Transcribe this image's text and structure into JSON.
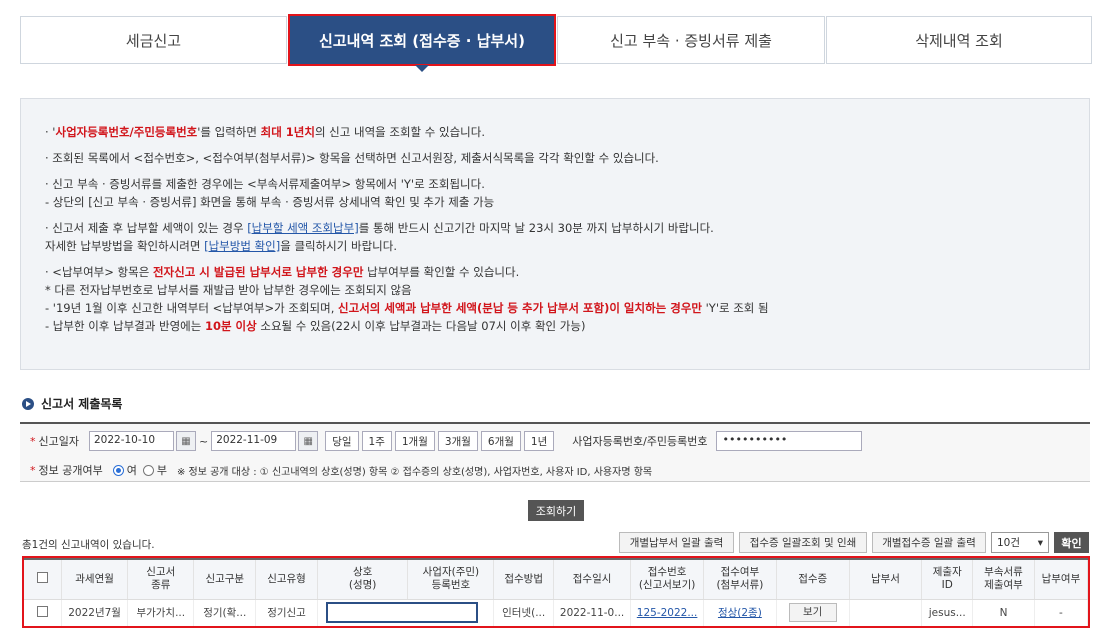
{
  "tabs": [
    {
      "label": "세금신고"
    },
    {
      "label": "신고내역 조회 (접수증 · 납부서)"
    },
    {
      "label": "신고 부속 · 증빙서류 제출"
    },
    {
      "label": "삭제내역 조회"
    }
  ],
  "info": {
    "l1_a": "· '",
    "l1_red1": "사업자등록번호/주민등록번호",
    "l1_b": "'를 입력하면 ",
    "l1_red2": "최대 1년치",
    "l1_c": "의 신고 내역을 조회할 수 있습니다.",
    "l2": "· 조회된 목록에서 <접수번호>, <접수여부(첨부서류)> 항목을 선택하면 신고서원장, 제출서식목록을 각각 확인할 수 있습니다.",
    "l3": "· 신고 부속 · 증빙서류를 제출한 경우에는 <부속서류제출여부> 항목에서 'Y'로 조회됩니다.",
    "l4": "  - 상단의 [신고 부속 · 증빙서류] 화면을 통해 부속 · 증빙서류 상세내역 확인 및 추가 제출 가능",
    "l5_a": "· 신고서 제출 후 납부할 세액이 있는 경우 ",
    "l5_link": "[납부할 세액 조회납부]",
    "l5_b": "를 통해 반드시 신고기간 마지막 날 23시 30분 까지 납부하시기 바랍니다.",
    "l6_a": "  자세한 납부방법을 확인하시려면 ",
    "l6_link": "[납부방법 확인]",
    "l6_b": "을 클릭하시기 바랍니다.",
    "l7_a": "· <납부여부> 항목은 ",
    "l7_red": "전자신고 시 발급된 납부서로 납부한 경우만",
    "l7_b": " 납부여부를 확인할 수 있습니다.",
    "l8": "   * 다른 전자납부번호로 납부서를 재발급 받아 납부한 경우에는 조회되지 않음",
    "l9_a": "  - '19년 1월 이후 신고한 내역부터 <납부여부>가 조회되며, ",
    "l9_red": "신고서의 세액과 납부한 세액(분납 등 추가 납부서 포함)이 일치하는 경우만",
    "l9_b": " 'Y'로 조회 됨",
    "l10_a": "  - 납부한 이후 납부결과 반영에는 ",
    "l10_red": "10분 이상",
    "l10_b": " 소요될 수 있음(22시 이후 납부결과는 다음날 07시 이후 확인 가능)"
  },
  "section_title": "신고서 제출목록",
  "search": {
    "date_label": "신고일자",
    "date_from": "2022-10-10",
    "date_to": "2022-11-09",
    "periods": [
      "당일",
      "1주",
      "1개월",
      "3개월",
      "6개월",
      "1년"
    ],
    "id_label": "사업자등록번호/주민등록번호",
    "id_value": "••••••••••",
    "public_label": "정보 공개여부",
    "opt_yes": "여",
    "opt_no": "부",
    "note": "※ 정보 공개 대상 : ① 신고내역의 상호(성명) 항목 ② 접수증의 상호(성명), 사업자번호, 사용자 ID, 사용자명 항목",
    "button": "조회하기"
  },
  "toolbar": {
    "count_text": "총1건의 신고내역이 있습니다.",
    "btn1": "개별납부서 일괄 출력",
    "btn2": "접수증 일괄조회 및 인쇄",
    "btn3": "개별접수증 일괄 출력",
    "page_size": "10건",
    "ok": "확인"
  },
  "table": {
    "headers": [
      "과세연월",
      "신고서\n종류",
      "신고구분",
      "신고유형",
      "상호\n(성명)",
      "사업자(주민)\n등록번호",
      "접수방법",
      "접수일시",
      "접수번호\n(신고서보기)",
      "접수여부\n(첨부서류)",
      "접수증",
      "납부서",
      "제출자\nID",
      "부속서류\n제출여부",
      "납부여부"
    ],
    "rows": [
      {
        "period": "2022년7월",
        "form": "부가가치...",
        "category": "정기(확...",
        "type": "정기신고",
        "name": "",
        "regno": "",
        "method": "인터넷(...",
        "datetime": "2022-11-0...",
        "receipt_no": "125-2022...",
        "status": "정상(2종)",
        "receipt_btn": "보기",
        "payment": "",
        "submitter": "jesus...",
        "attach": "N",
        "paid": "-"
      }
    ]
  }
}
